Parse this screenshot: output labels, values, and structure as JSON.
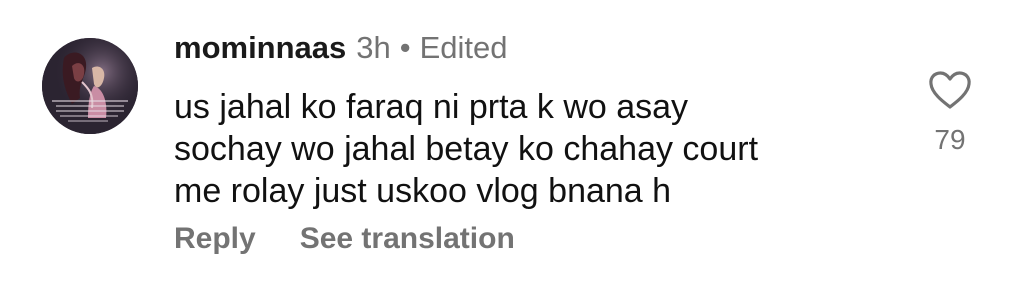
{
  "comment": {
    "username": "mominnaas",
    "time": "3h",
    "separator": "•",
    "status": "Edited",
    "lines": [
      "us jahal ko faraq ni prta k wo asay",
      "sochay wo jahal betay ko chahay court",
      "me rolay just uskoo vlog bnana h"
    ],
    "reply_label": "Reply",
    "translate_label": "See translation",
    "like_icon": "heart-outline-icon",
    "like_count": "79"
  },
  "colors": {
    "text": "#111111",
    "secondary": "#737373",
    "background": "#ffffff"
  }
}
